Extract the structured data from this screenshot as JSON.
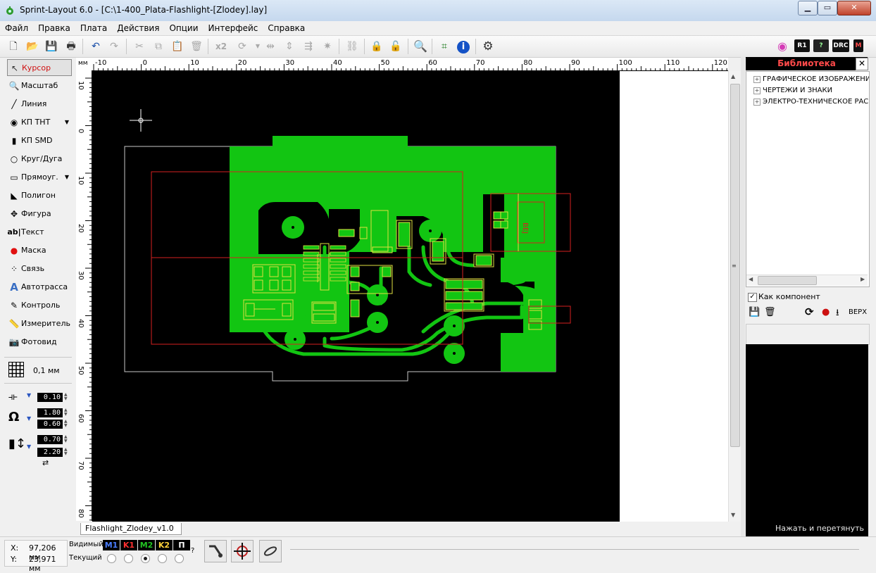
{
  "window": {
    "title": "Sprint-Layout 6.0 - [C:\\1-400_Plata-Flashlight-[Zlodey].lay]",
    "minimize_label": "▁",
    "maximize_label": "▭",
    "close_label": "✕"
  },
  "menu": {
    "items": [
      "Файл",
      "Правка",
      "Плата",
      "Действия",
      "Опции",
      "Интерфейс",
      "Справка"
    ]
  },
  "toolbar": {
    "x2_label": "x2",
    "r1_label": "R1",
    "drc_label": "DRC",
    "m_label": "M"
  },
  "tools": {
    "items": [
      "Курсор",
      "Масштаб",
      "Линия",
      "КП ТНТ",
      "КП SMD",
      "Круг/Дуга",
      "Прямоуг.",
      "Полигон",
      "Фигура",
      "Текст",
      "Маска",
      "Связь",
      "Автотрасса",
      "Контроль",
      "Измеритель",
      "Фотовид"
    ],
    "grid_value": "0,1 мм",
    "line_width": "0.10",
    "pad_outer": "1.80",
    "pad_inner": "0.60",
    "smd_w": "0.70",
    "smd_h": "2.20"
  },
  "ruler": {
    "unit": "мм",
    "top_ticks": [
      "-10",
      "0",
      "10",
      "20",
      "30",
      "40",
      "50",
      "60",
      "70",
      "80",
      "90",
      "100",
      "110",
      "120"
    ],
    "left_ticks": [
      "10",
      "0",
      "10",
      "20",
      "30",
      "40",
      "50",
      "60",
      "70",
      "80"
    ]
  },
  "pcb": {
    "label_text": "BEJ"
  },
  "tab": {
    "label": "Flashlight_Zlodey_v1.0"
  },
  "library": {
    "title": "Библиотека",
    "close_label": "✕",
    "items": [
      "ГРАФИЧЕСКОЕ ИЗОБРАЖЕНИЕ",
      "ЧЕРТЕЖИ И ЗНАКИ",
      "ЭЛЕКТРО-ТЕХНИЧЕСКОЕ РАСП"
    ],
    "as_component_label": "Как компонент",
    "side_label": "ВЕРХ",
    "hint": "Нажать и перетянуть"
  },
  "status": {
    "x_label": "X:",
    "x_value": "97,206 мм",
    "y_label": "Y:",
    "y_value": "23,971 мм",
    "visible_label": "Видимый",
    "current_label": "Текущий",
    "help_label": "?",
    "layers": [
      {
        "name": "M1",
        "color": "#4a7dff"
      },
      {
        "name": "K1",
        "color": "#ff3030"
      },
      {
        "name": "M2",
        "color": "#22c422"
      },
      {
        "name": "K2",
        "color": "#ffd23a"
      },
      {
        "name": "П",
        "color": "#ffffff"
      }
    ]
  },
  "colors": {
    "copper": "#12c512",
    "outline": "#c8c8c8",
    "silk": "#e0e040",
    "highlight": "#d62020",
    "canvas_bg": "#000000"
  }
}
